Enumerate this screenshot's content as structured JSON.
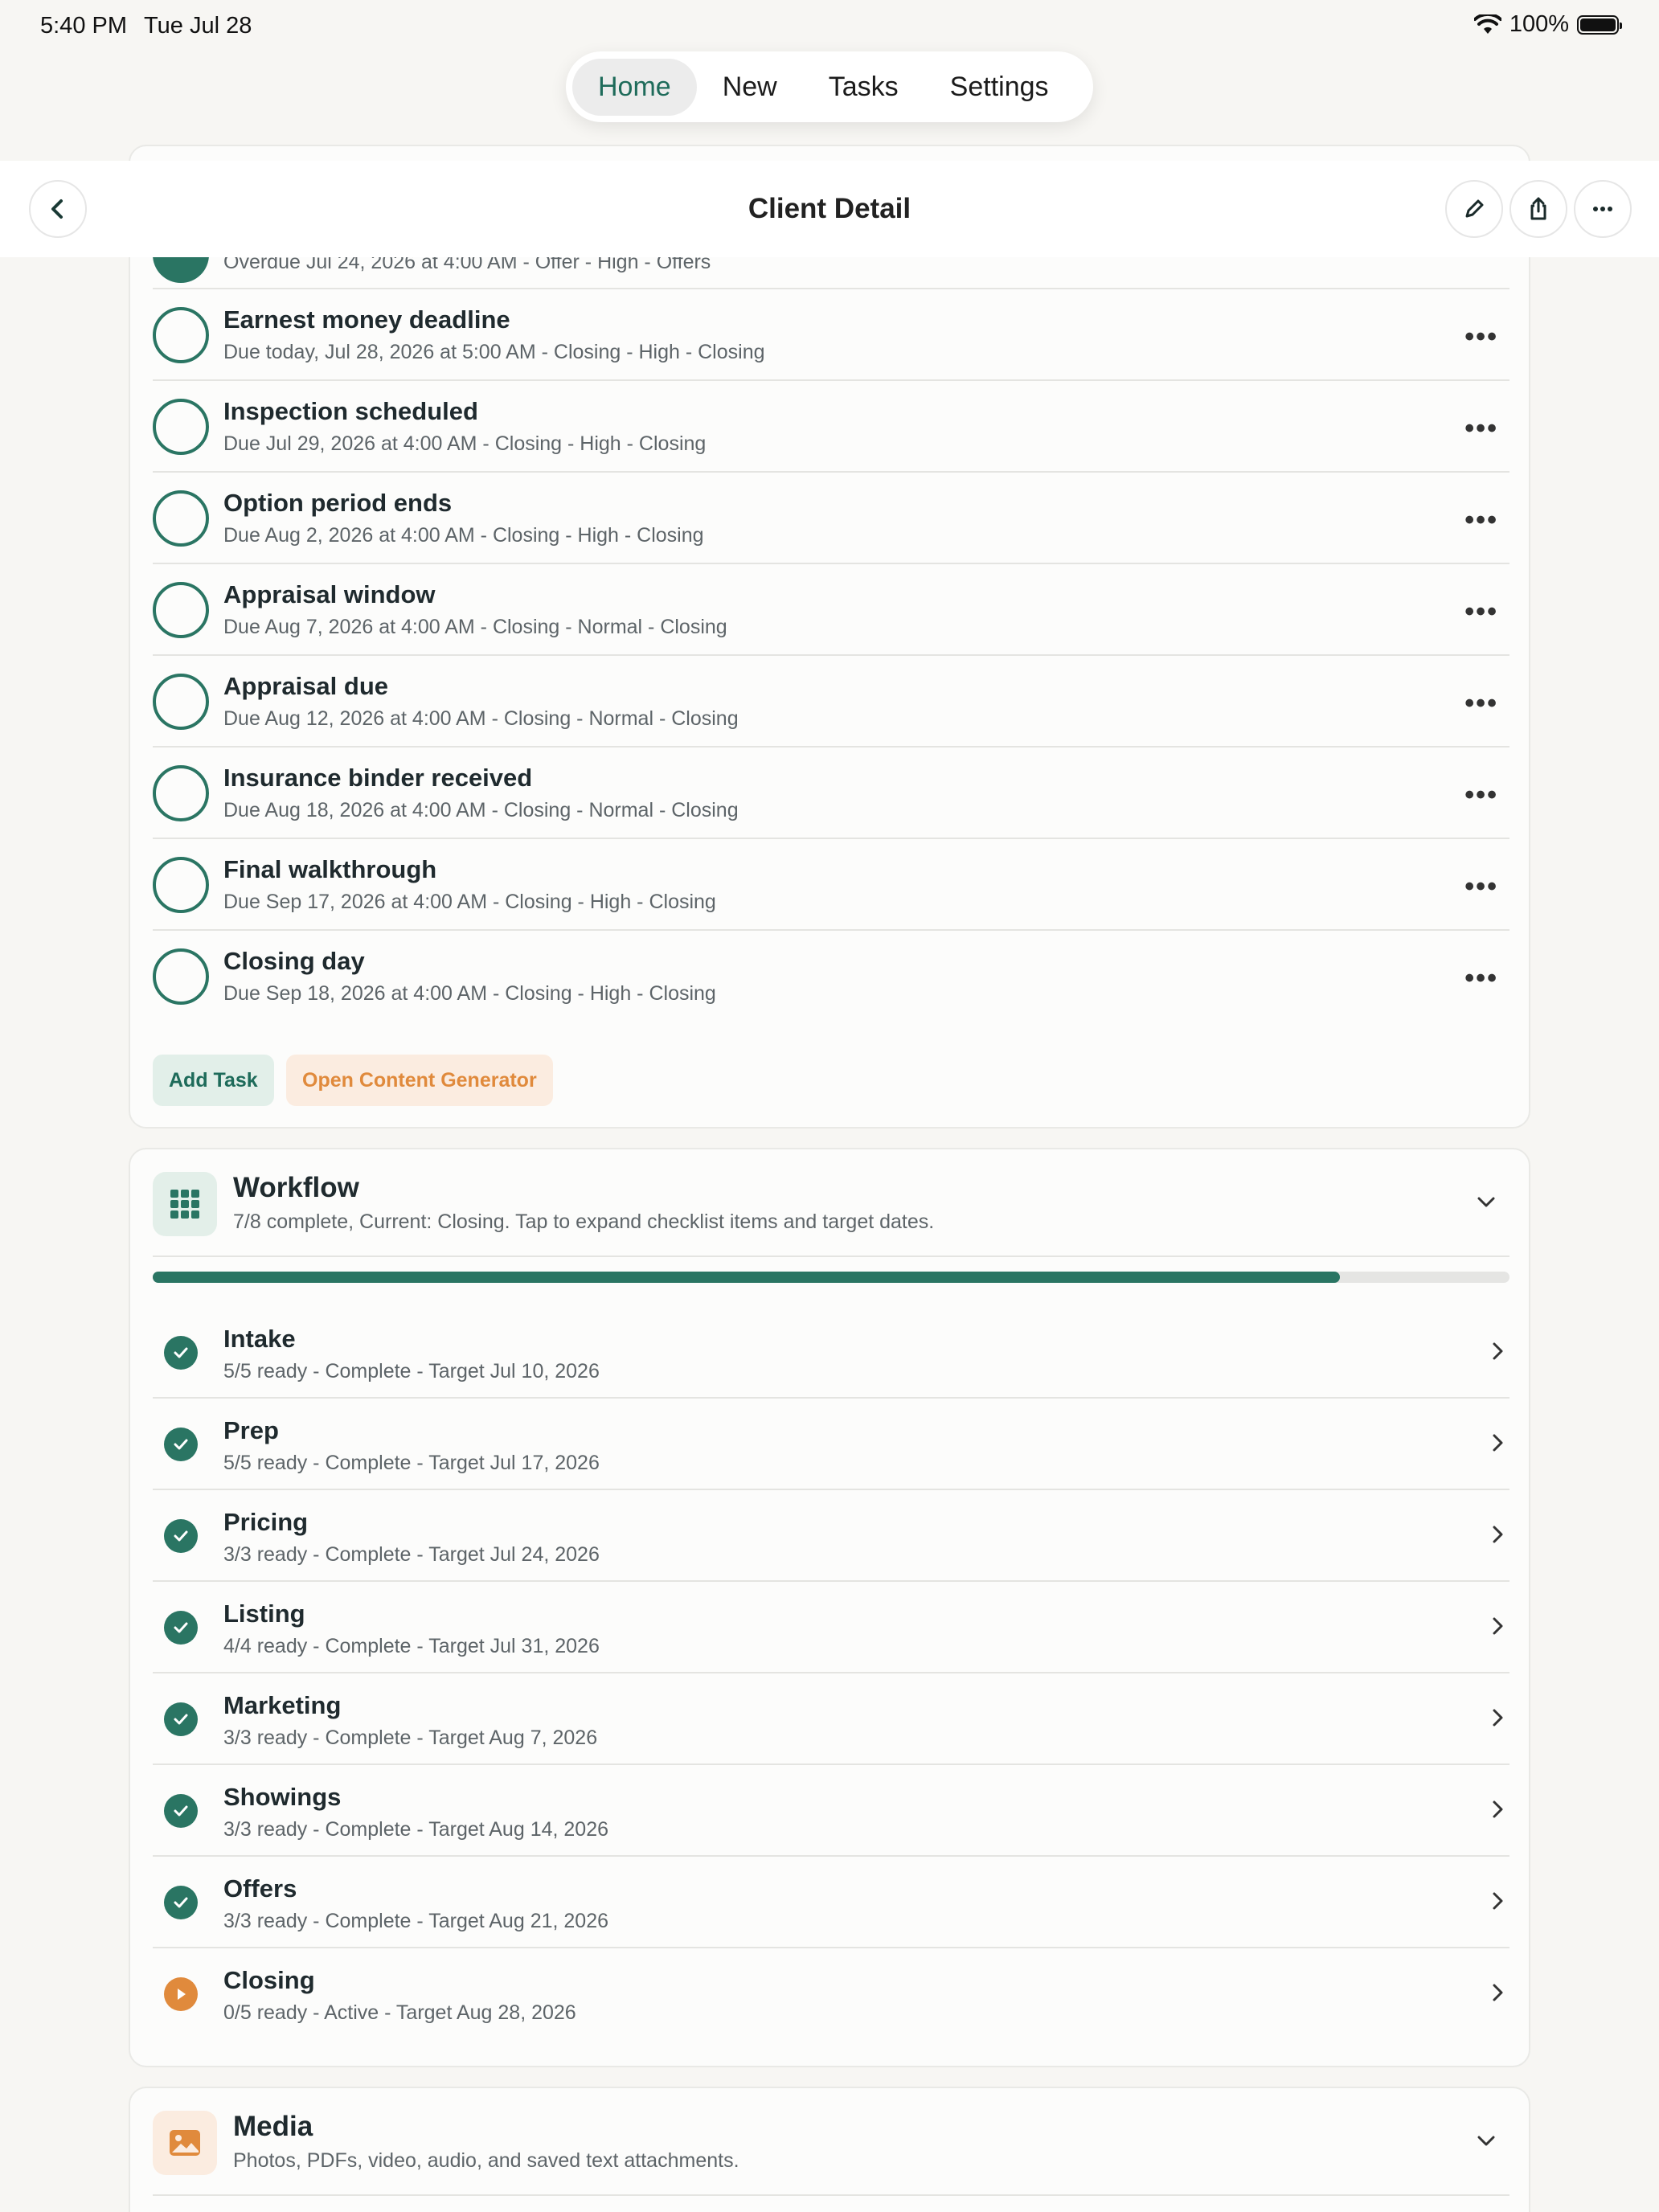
{
  "status": {
    "time": "5:40 PM",
    "date": "Tue Jul 28",
    "battery": "100%"
  },
  "tabs": [
    {
      "label": "Home",
      "active": true
    },
    {
      "label": "New"
    },
    {
      "label": "Tasks"
    },
    {
      "label": "Settings"
    }
  ],
  "header": {
    "title": "Client Detail"
  },
  "tasks": {
    "clipped_row_sub": "Overdue Jul 24, 2026 at 4:00 AM - Offer - High - Offers",
    "items": [
      {
        "title": "Earnest money deadline",
        "sub": "Due today, Jul 28, 2026 at 5:00 AM - Closing - High - Closing"
      },
      {
        "title": "Inspection scheduled",
        "sub": "Due Jul 29, 2026 at 4:00 AM - Closing - High - Closing"
      },
      {
        "title": "Option period ends",
        "sub": "Due Aug 2, 2026 at 4:00 AM - Closing - High - Closing"
      },
      {
        "title": "Appraisal window",
        "sub": "Due Aug 7, 2026 at 4:00 AM - Closing - Normal - Closing"
      },
      {
        "title": "Appraisal due",
        "sub": "Due Aug 12, 2026 at 4:00 AM - Closing - Normal - Closing"
      },
      {
        "title": "Insurance binder received",
        "sub": "Due Aug 18, 2026 at 4:00 AM - Closing - Normal - Closing"
      },
      {
        "title": "Final walkthrough",
        "sub": "Due Sep 17, 2026 at 4:00 AM - Closing - High - Closing"
      },
      {
        "title": "Closing day",
        "sub": "Due Sep 18, 2026 at 4:00 AM - Closing - High - Closing"
      }
    ],
    "add_label": "Add Task",
    "generator_label": "Open Content Generator"
  },
  "workflow": {
    "title": "Workflow",
    "subtitle": "7/8 complete, Current: Closing. Tap to expand checklist items and target dates.",
    "progress_fraction": 0.875,
    "stages": [
      {
        "title": "Intake",
        "sub": "5/5 ready - Complete - Target Jul 10, 2026",
        "state": "complete"
      },
      {
        "title": "Prep",
        "sub": "5/5 ready - Complete - Target Jul 17, 2026",
        "state": "complete"
      },
      {
        "title": "Pricing",
        "sub": "3/3 ready - Complete - Target Jul 24, 2026",
        "state": "complete"
      },
      {
        "title": "Listing",
        "sub": "4/4 ready - Complete - Target Jul 31, 2026",
        "state": "complete"
      },
      {
        "title": "Marketing",
        "sub": "3/3 ready - Complete - Target Aug 7, 2026",
        "state": "complete"
      },
      {
        "title": "Showings",
        "sub": "3/3 ready - Complete - Target Aug 14, 2026",
        "state": "complete"
      },
      {
        "title": "Offers",
        "sub": "3/3 ready - Complete - Target Aug 21, 2026",
        "state": "complete"
      },
      {
        "title": "Closing",
        "sub": "0/5 ready - Active - Target Aug 28, 2026",
        "state": "active"
      }
    ]
  },
  "media": {
    "title": "Media",
    "subtitle": "Photos, PDFs, video, audio, and saved text attachments."
  },
  "colors": {
    "accent": "#2a7563",
    "active": "#e08a3c",
    "background": "#f7f6f3"
  }
}
